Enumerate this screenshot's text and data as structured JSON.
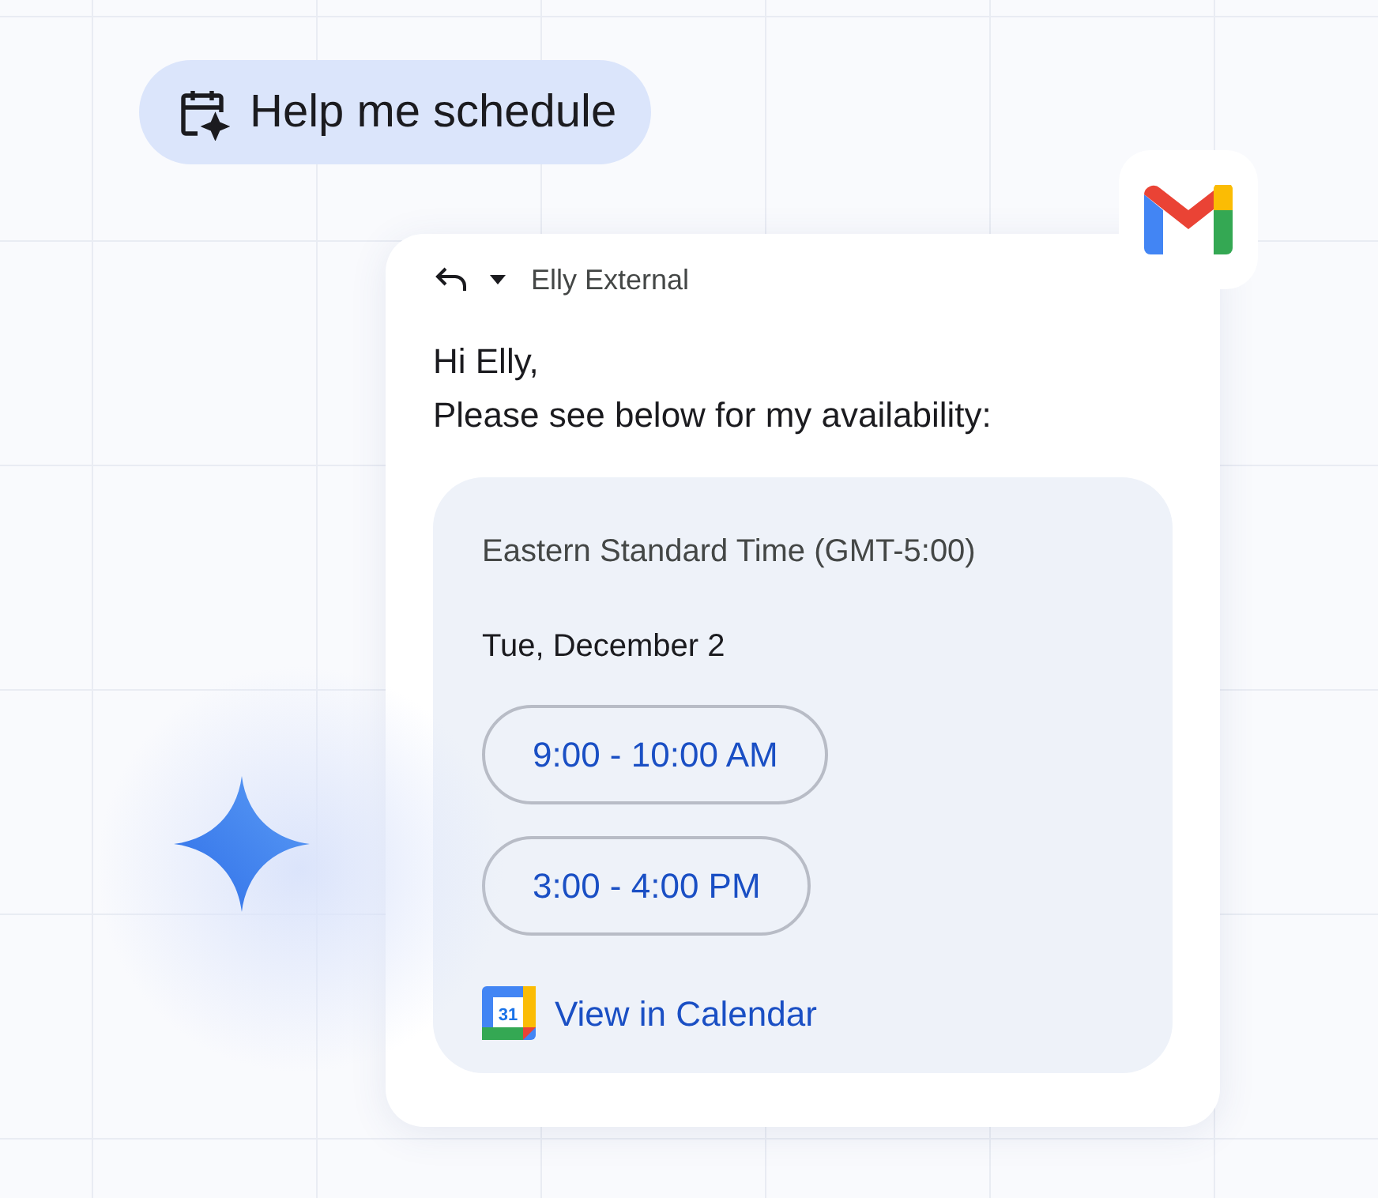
{
  "chip": {
    "label": "Help me schedule"
  },
  "email": {
    "recipient": "Elly External",
    "greeting": "Hi Elly,",
    "body": "Please see below for my availability:"
  },
  "availability": {
    "timezone": "Eastern Standard Time (GMT-5:00)",
    "date": "Tue, December 2",
    "slots": [
      {
        "label": "9:00 - 10:00 AM"
      },
      {
        "label": "3:00 - 4:00 PM"
      }
    ],
    "calendar_link": {
      "label": "View in Calendar",
      "icon_text": "31"
    }
  }
}
